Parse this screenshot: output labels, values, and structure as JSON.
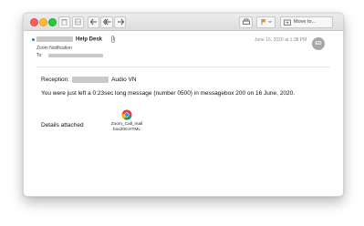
{
  "toolbar": {
    "moveto_label": "Move to..."
  },
  "message": {
    "from_name": "Help Desk",
    "subject": "Zoom Notification",
    "to_label": "To:",
    "date": "June 16, 2020 at 1:38 PM",
    "avatar_initials": "ED"
  },
  "body": {
    "reception_prefix": "Reception:",
    "reception_suffix": "Audio VN",
    "message_text": "You were just left a 0:23sec long message (number 0500) in messagebox 200 on 16 June, 2020.",
    "details_label": "Details attached",
    "attachment_name_line1": "Zoom_Call_mail",
    "attachment_name_line2": "box200.HTML"
  },
  "colors": {
    "close": "#fd5f57",
    "minimize": "#febc2e",
    "zoom": "#28c840",
    "unread": "#1f7cff",
    "flag": "#f08a24",
    "avatar": "#a4a8ad"
  },
  "icons": [
    "trash-icon",
    "junk-icon",
    "reply-icon",
    "reply-all-icon",
    "forward-icon",
    "print-icon",
    "flag-icon",
    "move-to-folder-icon",
    "paperclip-icon",
    "chrome-html-file-icon"
  ]
}
